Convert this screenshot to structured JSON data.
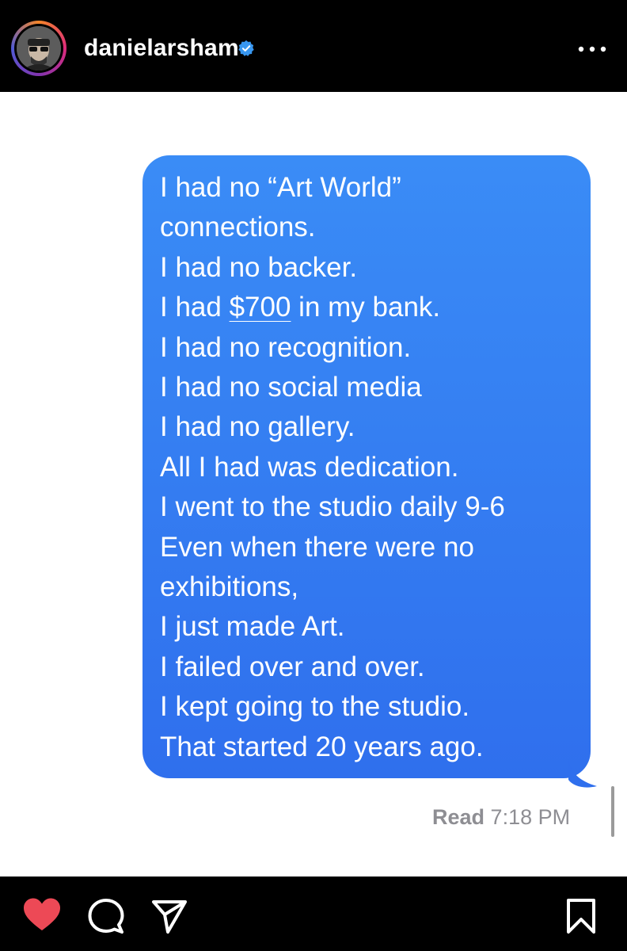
{
  "header": {
    "username": "danielarsham",
    "verified": true,
    "avatar_icon": "avatar",
    "more_icon": "more-options-icon"
  },
  "message": {
    "lines": [
      "I had no “Art World”",
      "connections.",
      "I had no backer.",
      "I had $700 in my bank.",
      "I had no recognition.",
      "I had no social media",
      "I had no gallery.",
      "All I had was dedication.",
      "I went to the studio daily 9-6",
      "Even when there were no",
      "exhibitions,",
      "I just made Art.",
      "I failed over and over.",
      "I kept going to the studio.",
      "That started 20 years ago."
    ],
    "underlined_amount": "$700",
    "bubble_color": "#3478f6"
  },
  "receipt": {
    "status": "Read",
    "time": "7:18 PM"
  },
  "footer": {
    "icons": [
      "heart-icon",
      "comment-icon",
      "share-icon",
      "bookmark-icon"
    ],
    "heart_color": "#ed4956"
  }
}
